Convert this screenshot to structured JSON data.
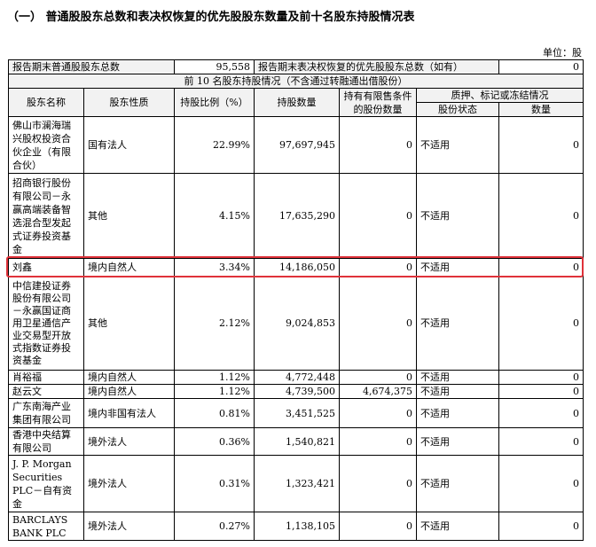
{
  "title": "（一） 普通股股东总数和表决权恢复的优先股股东数量及前十名股东持股情况表",
  "unit": "单位：股",
  "summary": {
    "label_common": "报告期末普通股股东总数",
    "value_common": "95,558",
    "label_pref": "报告期末表决权恢复的优先股股东总数（如有）",
    "value_pref": "0"
  },
  "section_title": "前 10 名股东持股情况（不含通过转融通出借股份）",
  "headers": {
    "name": "股东名称",
    "nature": "股东性质",
    "ratio": "持股比例（%）",
    "shares": "持股数量",
    "restricted": "持有有限售条件的股份数量",
    "pledge_group": "质押、标记或冻结情况",
    "pledge_status": "股份状态",
    "pledge_qty": "数量"
  },
  "rows": [
    {
      "name": "佛山市澜海瑞兴股权投资合伙企业（有限合伙）",
      "nature": "国有法人",
      "ratio": "22.99%",
      "shares": "97,697,945",
      "restricted": "0",
      "status": "不适用",
      "qty": "0"
    },
    {
      "name": "招商银行股份有限公司－永赢高端装备智选混合型发起式证券投资基金",
      "nature": "其他",
      "ratio": "4.15%",
      "shares": "17,635,290",
      "restricted": "0",
      "status": "不适用",
      "qty": "0"
    },
    {
      "name": "刘鑫",
      "nature": "境内自然人",
      "ratio": "3.34%",
      "shares": "14,186,050",
      "restricted": "0",
      "status": "不适用",
      "qty": "0"
    },
    {
      "name": "中信建投证券股份有限公司－永赢国证商用卫星通信产业交易型开放式指数证券投资基金",
      "nature": "其他",
      "ratio": "2.12%",
      "shares": "9,024,853",
      "restricted": "0",
      "status": "不适用",
      "qty": "0"
    },
    {
      "name": "肖裕福",
      "nature": "境内自然人",
      "ratio": "1.12%",
      "shares": "4,772,448",
      "restricted": "0",
      "status": "不适用",
      "qty": "0"
    },
    {
      "name": "赵云文",
      "nature": "境内自然人",
      "ratio": "1.12%",
      "shares": "4,739,500",
      "restricted": "4,674,375",
      "status": "不适用",
      "qty": "0"
    },
    {
      "name": "广东南海产业集团有限公司",
      "nature": "境内非国有法人",
      "ratio": "0.81%",
      "shares": "3,451,525",
      "restricted": "0",
      "status": "不适用",
      "qty": "0"
    },
    {
      "name": "香港中央结算有限公司",
      "nature": "境外法人",
      "ratio": "0.36%",
      "shares": "1,540,821",
      "restricted": "0",
      "status": "不适用",
      "qty": "0"
    },
    {
      "name": "J. P. Morgan Securities PLC－自有资金",
      "nature": "境外法人",
      "ratio": "0.31%",
      "shares": "1,323,421",
      "restricted": "0",
      "status": "不适用",
      "qty": "0"
    },
    {
      "name": "BARCLAYS BANK PLC",
      "nature": "境外法人",
      "ratio": "0.27%",
      "shares": "1,138,105",
      "restricted": "0",
      "status": "不适用",
      "qty": "0"
    }
  ],
  "highlight_color": "#e0323a"
}
